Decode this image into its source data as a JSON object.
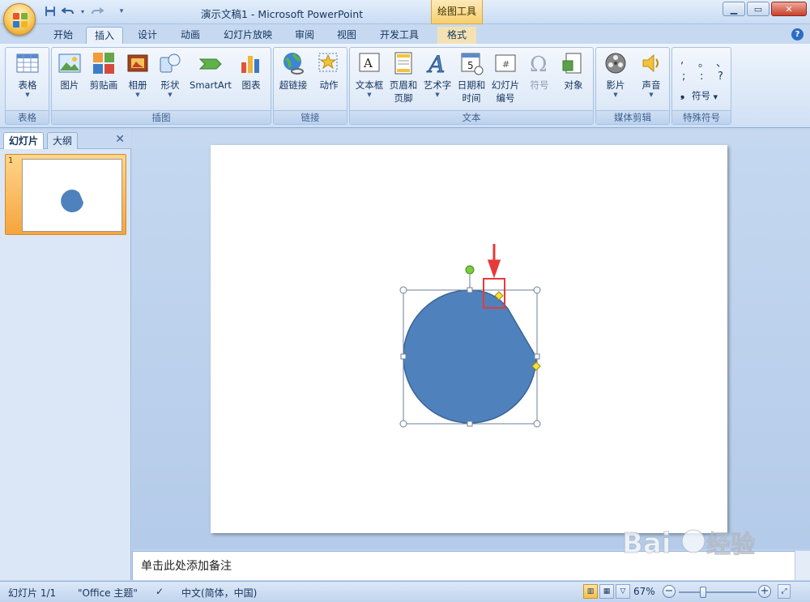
{
  "window": {
    "title": "演示文稿1 - Microsoft PowerPoint",
    "context_tab": "绘图工具"
  },
  "tabs": [
    "开始",
    "插入",
    "设计",
    "动画",
    "幻灯片放映",
    "审阅",
    "视图",
    "开发工具",
    "格式"
  ],
  "active_tab": "插入",
  "ribbon": {
    "groups": {
      "table": "表格",
      "illustrations": "插图",
      "links": "链接",
      "text": "文本",
      "media": "媒体剪辑",
      "symbols": "特殊符号"
    },
    "buttons": {
      "table": "表格",
      "picture": "图片",
      "clipart": "剪贴画",
      "album": "相册",
      "shapes": "形状",
      "smartart": "SmartArt",
      "chart": "图表",
      "hyperlink": "超链接",
      "action": "动作",
      "textbox": "文本框",
      "header_footer_1": "页眉和",
      "header_footer_2": "页脚",
      "wordart": "艺术字",
      "datetime_1": "日期和",
      "datetime_2": "时间",
      "slide_num_1": "幻灯片",
      "slide_num_2": "编号",
      "symbol": "符号",
      "object": "对象",
      "movie": "影片",
      "sound": "声音",
      "symbol_dropdown": "符号"
    }
  },
  "left_pane": {
    "tab_slides": "幻灯片",
    "tab_outline": "大纲",
    "slide_number": "1"
  },
  "notes_placeholder": "单击此处添加备注",
  "status": {
    "slide_info": "幻灯片 1/1",
    "theme": "\"Office 主题\"",
    "language": "中文(简体，中国)",
    "zoom": "67%",
    "zoom_value": 0.67
  },
  "colors": {
    "shape_fill": "#4f81bd",
    "shape_stroke": "#3a6596",
    "annotation_red": "#e53a3a"
  },
  "icons": [
    "office-button-icon",
    "save-icon",
    "undo-icon",
    "redo-icon",
    "customize-icon",
    "help-icon"
  ]
}
